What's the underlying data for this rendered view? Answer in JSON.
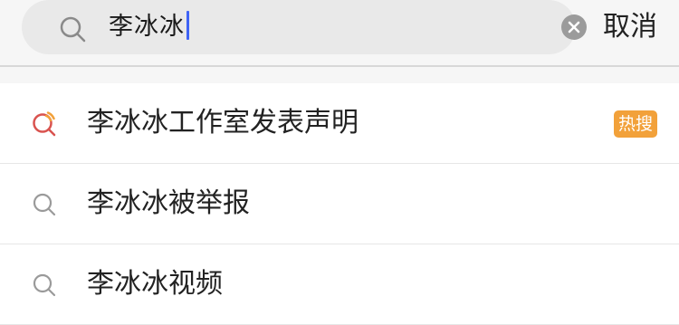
{
  "search": {
    "query": "李冰冰",
    "icon": "search-icon",
    "clear_icon": "clear-icon"
  },
  "header": {
    "cancel_label": "取消"
  },
  "suggestions": [
    {
      "label": "李冰冰工作室发表声明",
      "icon": "hot-search-icon",
      "badge": "热搜",
      "badge_color": "#f2a13a"
    },
    {
      "label": "李冰冰被举报",
      "icon": "search-icon"
    },
    {
      "label": "李冰冰视频",
      "icon": "search-icon"
    }
  ],
  "colors": {
    "caret": "#3e63f5",
    "hot_icon_ring": "#d9534f",
    "hot_icon_accent": "#f2a13a"
  }
}
